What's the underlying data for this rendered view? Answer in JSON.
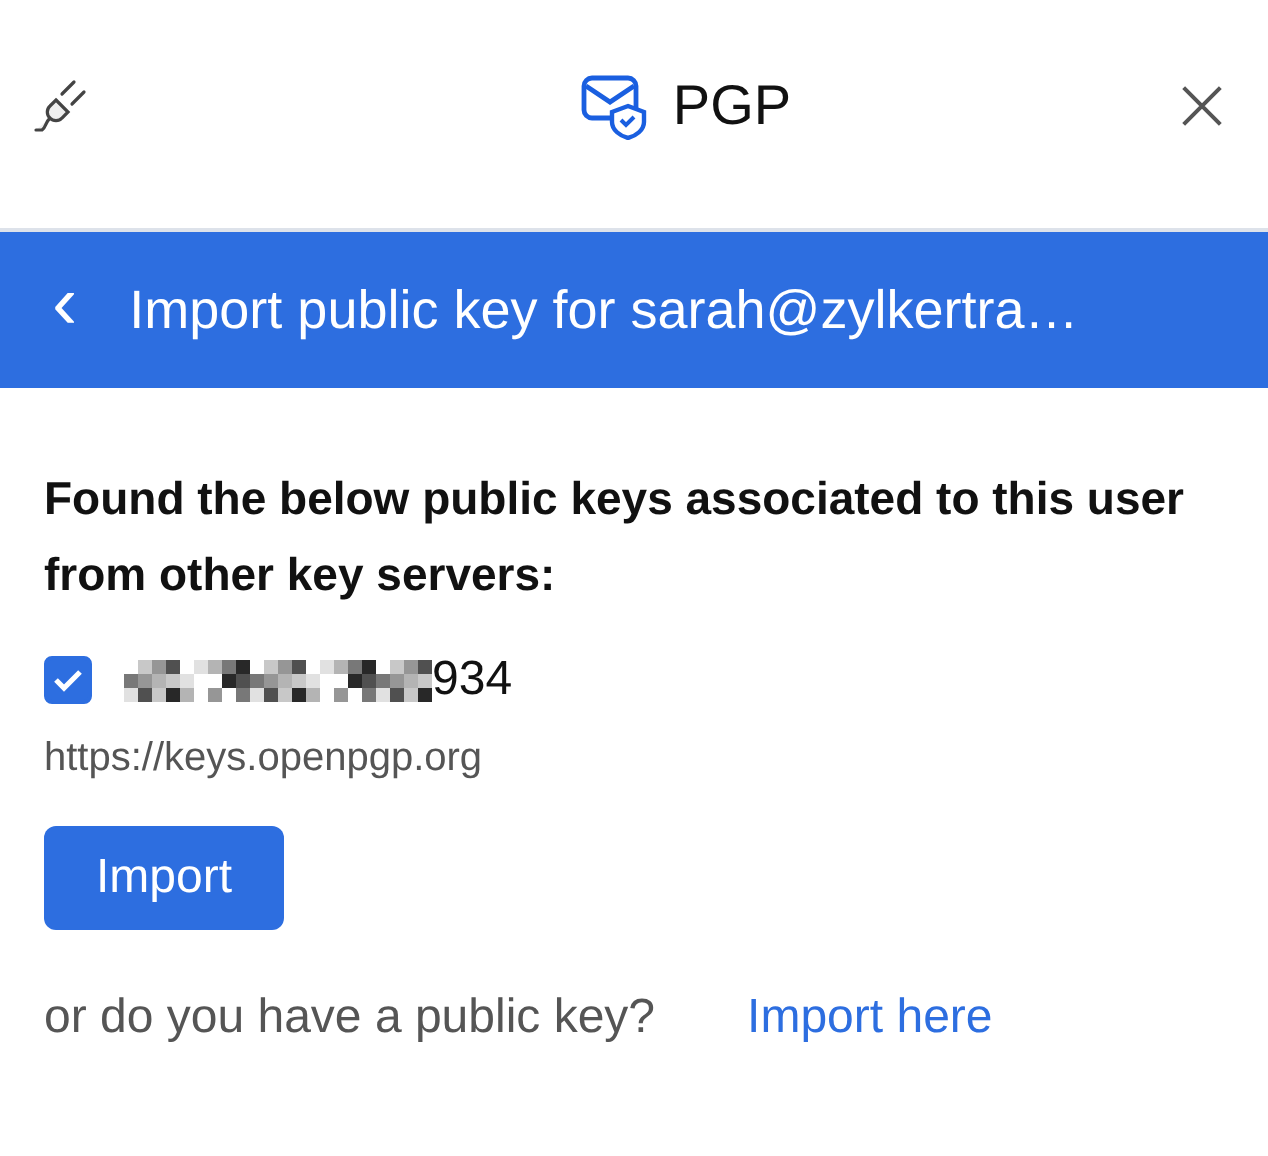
{
  "header": {
    "title": "PGP"
  },
  "banner": {
    "back": "‹",
    "title": "Import public key for sarah@zylkertra…"
  },
  "message": "Found the below public keys associated to this user from other key servers:",
  "keys": [
    {
      "checked": true,
      "id_suffix": "934",
      "server": "https://keys.openpgp.org"
    }
  ],
  "import_button": "Import",
  "footer": {
    "question": "or do you have a public key?",
    "link": "Import here"
  }
}
